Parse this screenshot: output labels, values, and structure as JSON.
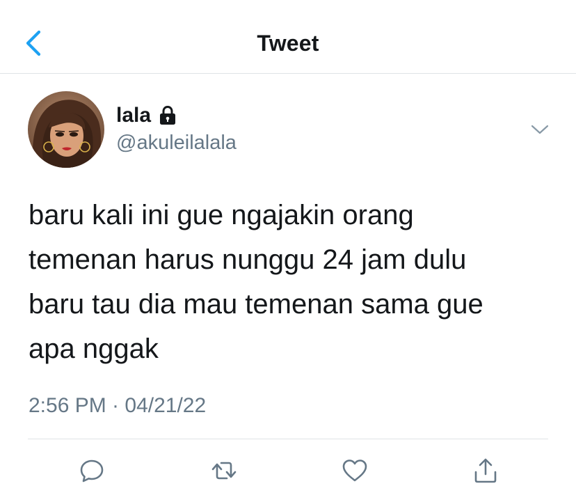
{
  "header": {
    "title": "Tweet",
    "back_icon": "chevron-left-icon",
    "accent_color": "#1da1f2"
  },
  "tweet": {
    "author": {
      "display_name": "lala",
      "username": "@akuleilalala",
      "protected_icon": "lock-icon"
    },
    "text": "baru kali ini gue ngajakin orang\ntemenan harus nunggu 24 jam dulu\nbaru tau dia mau temenan sama gue\napa nggak",
    "timestamp": "2:56 PM · 04/21/22",
    "more_icon": "chevron-down-icon"
  },
  "actions": [
    {
      "name": "reply",
      "icon": "reply-icon"
    },
    {
      "name": "retweet",
      "icon": "retweet-icon"
    },
    {
      "name": "like",
      "icon": "heart-icon"
    },
    {
      "name": "share",
      "icon": "share-icon"
    }
  ],
  "colors": {
    "text_primary": "#14171a",
    "text_secondary": "#657786",
    "divider": "#dfe3e6",
    "icon": "#657786"
  }
}
